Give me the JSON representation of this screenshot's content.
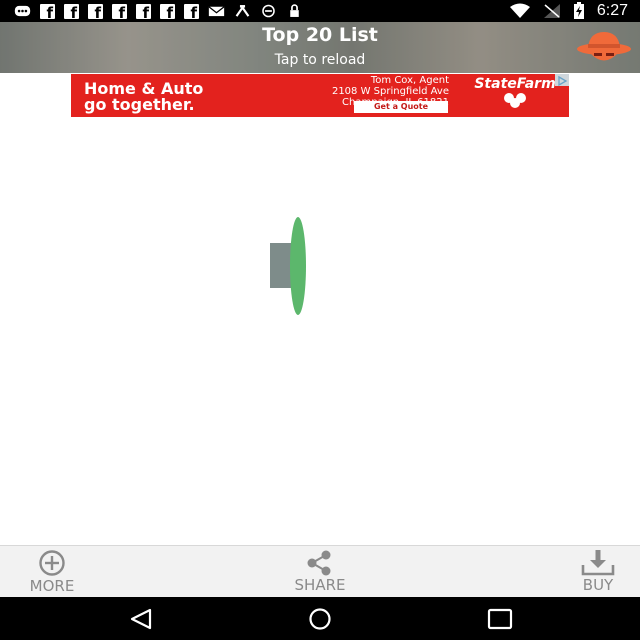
{
  "status_bar": {
    "time": "6:27",
    "left_icons": [
      "message-icon",
      "facebook-icon",
      "facebook-icon",
      "facebook-icon",
      "facebook-icon",
      "facebook-icon",
      "facebook-icon",
      "facebook-icon",
      "mail-icon",
      "fan-icon",
      "circle-minus-icon",
      "lock-icon"
    ],
    "right_icons": [
      "wifi-icon",
      "signal-off-icon",
      "battery-charging-icon"
    ]
  },
  "header": {
    "title": "Top 20 List",
    "subtitle": "Tap to reload",
    "logo_icon": "hat-spy-icon"
  },
  "ad": {
    "headline_line1": "Home & Auto",
    "headline_line2": "go together.",
    "agent_name": "Tom Cox, Agent",
    "agent_address1": "2108 W Springfield Ave",
    "agent_address2": "Champaign, IL 61821",
    "cta": "Get a Quote",
    "brand": "StateFarm",
    "badge_icon": "ad-choices-icon"
  },
  "loader_icon": "loading-spinner-icon",
  "toolbar": {
    "more_label": "MORE",
    "share_label": "SHARE",
    "buy_label": "BUY"
  },
  "colors": {
    "ad_red": "#e3221e",
    "accent_orange": "#f06a3a",
    "loader_green": "#5cb76c",
    "loader_gray": "#7e8c8a"
  }
}
